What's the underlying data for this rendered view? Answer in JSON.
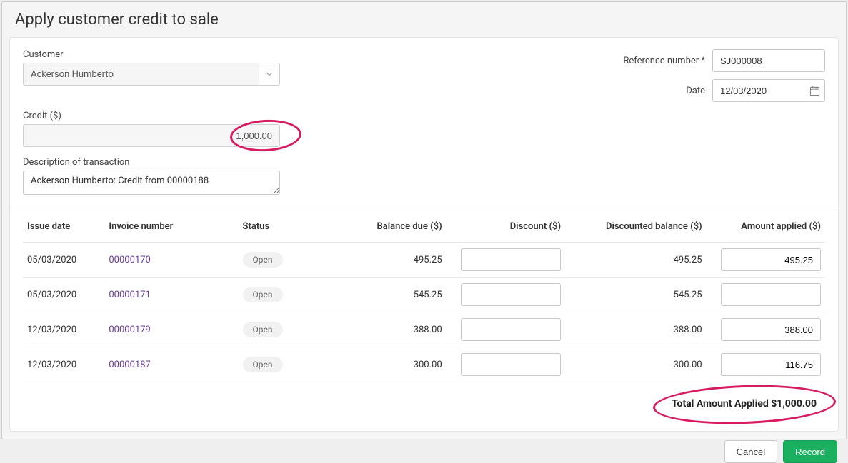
{
  "header": {
    "title": "Apply customer credit to sale"
  },
  "customer": {
    "label": "Customer",
    "value": "Ackerson Humberto"
  },
  "reference": {
    "label": "Reference number *",
    "value": "SJ000008"
  },
  "date": {
    "label": "Date",
    "value": "12/03/2020"
  },
  "credit": {
    "label": "Credit ($)",
    "value": "1,000.00"
  },
  "description": {
    "label": "Description of transaction",
    "value": "Ackerson Humberto: Credit from 00000188"
  },
  "table": {
    "headers": {
      "issue_date": "Issue date",
      "invoice_number": "Invoice number",
      "status": "Status",
      "balance_due": "Balance due ($)",
      "discount": "Discount ($)",
      "discounted_balance": "Discounted balance ($)",
      "amount_applied": "Amount applied ($)"
    },
    "rows": [
      {
        "issue_date": "05/03/2020",
        "invoice_number": "00000170",
        "status": "Open",
        "balance_due": "495.25",
        "discount": "",
        "discounted_balance": "495.25",
        "amount_applied": "495.25"
      },
      {
        "issue_date": "05/03/2020",
        "invoice_number": "00000171",
        "status": "Open",
        "balance_due": "545.25",
        "discount": "",
        "discounted_balance": "545.25",
        "amount_applied": ""
      },
      {
        "issue_date": "12/03/2020",
        "invoice_number": "00000179",
        "status": "Open",
        "balance_due": "388.00",
        "discount": "",
        "discounted_balance": "388.00",
        "amount_applied": "388.00"
      },
      {
        "issue_date": "12/03/2020",
        "invoice_number": "00000187",
        "status": "Open",
        "balance_due": "300.00",
        "discount": "",
        "discounted_balance": "300.00",
        "amount_applied": "116.75"
      }
    ]
  },
  "totals": {
    "label": "Total Amount Applied",
    "value": "$1,000.00"
  },
  "footer": {
    "cancel": "Cancel",
    "record": "Record"
  }
}
